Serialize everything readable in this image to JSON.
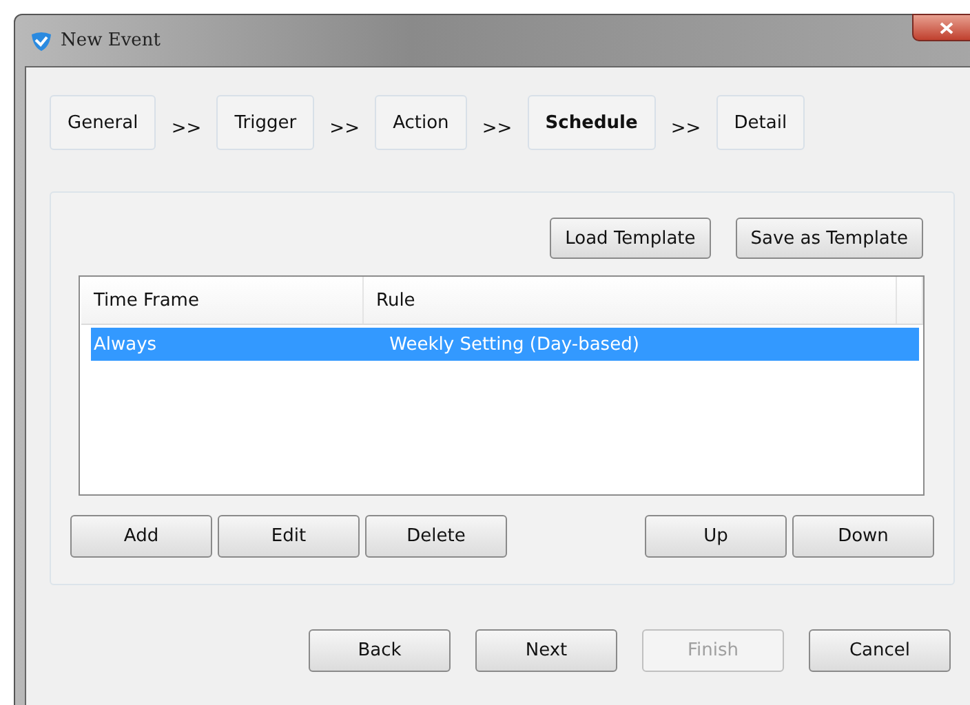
{
  "window": {
    "title": "New Event"
  },
  "steps": [
    {
      "kind": "step",
      "label": "General",
      "selected": false
    },
    {
      "kind": "separator",
      "label": ">>"
    },
    {
      "kind": "step",
      "label": "Trigger",
      "selected": false
    },
    {
      "kind": "separator",
      "label": ">>"
    },
    {
      "kind": "step",
      "label": "Action",
      "selected": false
    },
    {
      "kind": "separator",
      "label": ">>"
    },
    {
      "kind": "step",
      "label": "Schedule",
      "selected": true
    },
    {
      "kind": "separator",
      "label": ">>"
    },
    {
      "kind": "step",
      "label": "Detail",
      "selected": false
    }
  ],
  "template_buttons": [
    "Load Template",
    "Save as Template"
  ],
  "table": {
    "columns": [
      "Time Frame",
      "Rule"
    ],
    "rows": [
      {
        "cells": [
          "Always",
          "Weekly Setting (Day-based)"
        ],
        "selected": true
      }
    ]
  },
  "list_buttons_left": [
    "Add",
    "Edit",
    "Delete"
  ],
  "list_buttons_right": [
    "Up",
    "Down"
  ],
  "footer_buttons": [
    {
      "label": "Back",
      "disabled": false
    },
    {
      "label": "Next",
      "disabled": false
    },
    {
      "label": "Finish",
      "disabled": true
    },
    {
      "label": "Cancel",
      "disabled": false
    }
  ]
}
